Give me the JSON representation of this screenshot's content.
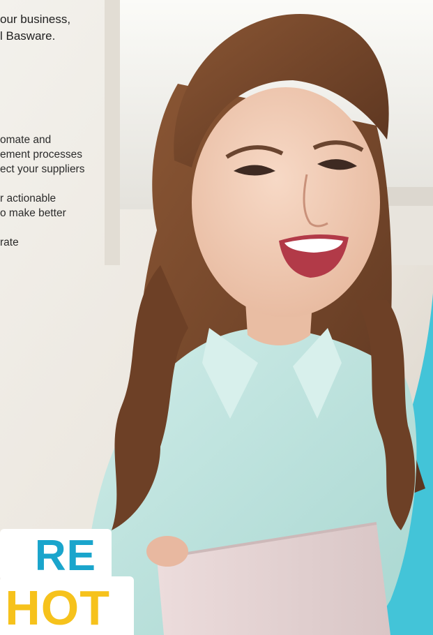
{
  "intro": {
    "lines": [
      "our business,",
      "l Basware."
    ]
  },
  "bullets": [
    {
      "lines": [
        "omate and",
        "ement processes",
        "ect your suppliers"
      ]
    },
    {
      "lines": [
        "r actionable",
        "o make better"
      ]
    },
    {
      "lines": [
        "rate"
      ]
    }
  ],
  "badges": {
    "line1": "RE",
    "line2": "HOT"
  },
  "colors": {
    "teal": "#43c4d8",
    "blue_text": "#1aa5cc",
    "yellow_text": "#f6c21c",
    "shirt": "#bfe3df",
    "hair": "#7a4a2c"
  }
}
